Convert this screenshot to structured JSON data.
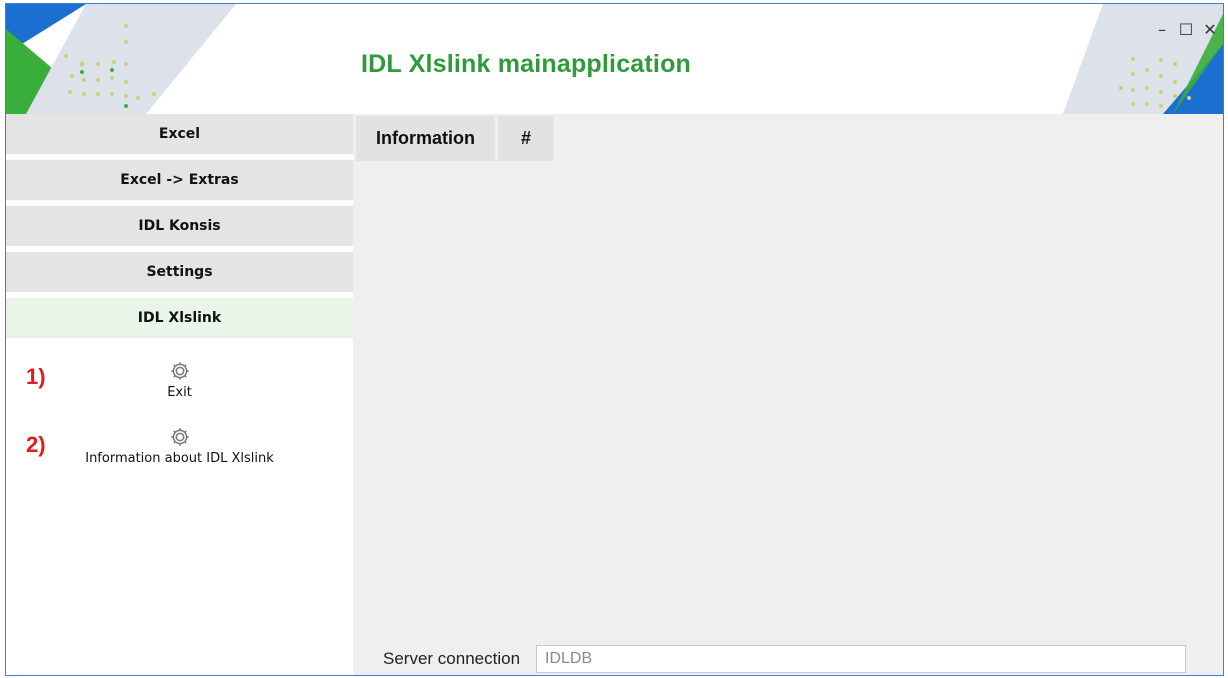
{
  "window": {
    "title": "IDL Xlslink mainapplication",
    "controls": {
      "minimize": "–",
      "maximize": "☐",
      "close": "✕"
    }
  },
  "sidebar": {
    "menu": [
      {
        "label": "Excel",
        "active": false
      },
      {
        "label": "Excel -> Extras",
        "active": false
      },
      {
        "label": "IDL Konsis",
        "active": false
      },
      {
        "label": "Settings",
        "active": false
      },
      {
        "label": "IDL Xlslink",
        "active": true
      }
    ],
    "submenu": [
      {
        "label": "Exit",
        "icon": "gear-icon",
        "annotation": "1)"
      },
      {
        "label": "Information about IDL Xlslink",
        "icon": "gear-icon",
        "annotation": "2)"
      }
    ]
  },
  "content": {
    "tabs": [
      {
        "label": "Information"
      },
      {
        "label": "#"
      }
    ]
  },
  "status": {
    "server_label": "Server connection",
    "server_value": "IDLDB"
  },
  "colors": {
    "title_green": "#2e9a3a",
    "brand_blue": "#1a6fd0",
    "brand_green": "#3aae3a",
    "annotation_red": "#e21b1b",
    "window_border": "#3c7ed0"
  }
}
